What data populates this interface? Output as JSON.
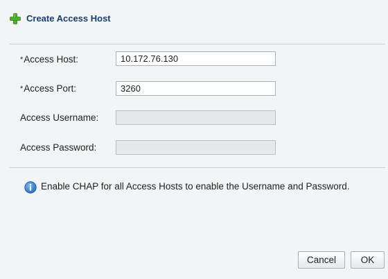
{
  "dialog": {
    "title": "Create Access Host",
    "title_icon": "add-plus-icon",
    "accent_color": "#4caf2a"
  },
  "fields": {
    "access_host": {
      "required_marker": "*",
      "label": "Access Host:",
      "value": "10.172.76.130",
      "enabled": true
    },
    "access_port": {
      "required_marker": "*",
      "label": "Access Port:",
      "value": "3260",
      "enabled": true
    },
    "access_username": {
      "label": "Access Username:",
      "value": "",
      "enabled": false
    },
    "access_password": {
      "label": "Access Password:",
      "value": "",
      "enabled": false
    }
  },
  "info": {
    "icon": "info-icon",
    "message": "Enable CHAP for all Access Hosts to enable the Username and Password."
  },
  "buttons": {
    "cancel_label": "Cancel",
    "ok_label": "OK"
  }
}
